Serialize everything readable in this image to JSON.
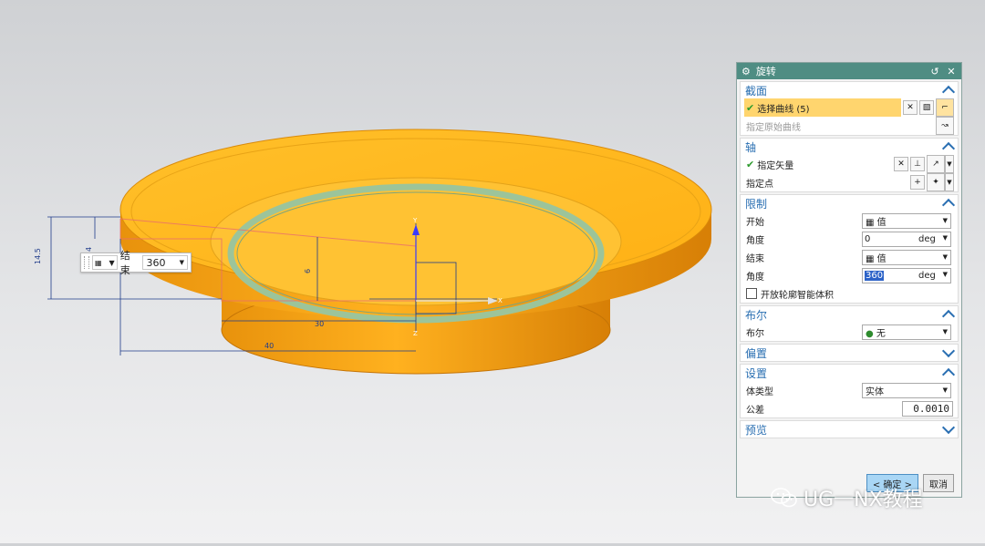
{
  "viewport": {
    "dimensions": [
      "14.5",
      "4",
      "6",
      "30",
      "40"
    ],
    "axis_labels": {
      "y": "Y",
      "x": "X",
      "z": "Z"
    },
    "float_bar": {
      "label": "结束",
      "value": "360"
    }
  },
  "dialog": {
    "title": "旋转",
    "sections": {
      "section": {
        "title": "截面",
        "select_curve": "选择曲线 (5)",
        "specify_origin_curve": "指定原始曲线"
      },
      "axis": {
        "title": "轴",
        "specify_vector": "指定矢量",
        "specify_point": "指定点"
      },
      "limits": {
        "title": "限制",
        "start_label": "开始",
        "start_value": "值",
        "start_angle_label": "角度",
        "start_angle": "0",
        "end_label": "结束",
        "end_value": "值",
        "end_angle_label": "角度",
        "end_angle": "360",
        "unit": "deg",
        "open_profile": "开放轮廓智能体积"
      },
      "boolean": {
        "title": "布尔",
        "label": "布尔",
        "value": "无"
      },
      "offset": {
        "title": "偏置"
      },
      "settings": {
        "title": "设置",
        "body_type_label": "体类型",
        "body_type": "实体",
        "tolerance_label": "公差",
        "tolerance": "0.0010"
      },
      "preview": {
        "title": "预览"
      }
    },
    "buttons": {
      "ok": "< 确定 >",
      "cancel": "取消"
    }
  },
  "watermark": {
    "text": "UG一NX教程"
  },
  "colors": {
    "model_top": "#ffbb22",
    "model_side": "#f09a10",
    "titlebar": "#4f8d83",
    "section_heading": "#2a6fb2",
    "highlight_row": "#ffd56e",
    "ring": "#a8c89a"
  }
}
